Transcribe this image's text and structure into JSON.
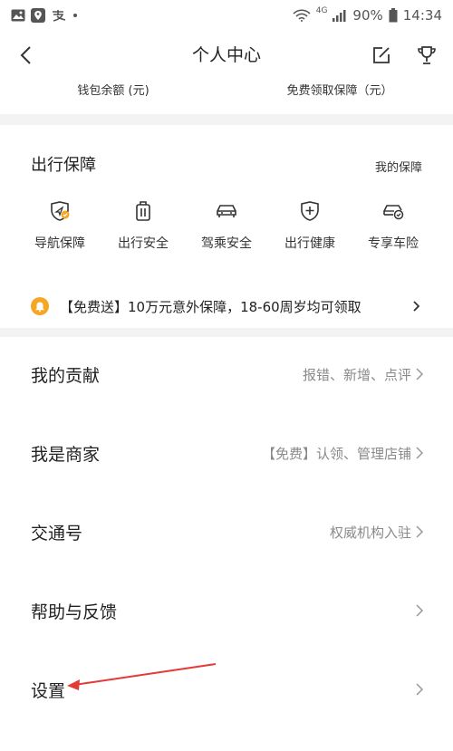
{
  "status_bar": {
    "battery_percent": "90%",
    "time": "14:34",
    "network": "4G",
    "icons": [
      "image-icon",
      "location-icon",
      "alipay-icon",
      "dot-icon",
      "wifi-icon",
      "signal-icon",
      "battery-icon"
    ]
  },
  "nav": {
    "title": "个人中心",
    "icons": [
      "back-arrow-icon",
      "edit-icon",
      "trophy-icon"
    ]
  },
  "wallet": {
    "balance_label": "钱包余额 (元)",
    "free_protect_label": "免费领取保障（元）"
  },
  "protect": {
    "title": "出行保障",
    "link": "我的保障",
    "items": [
      {
        "label": "导航保障",
        "icon": "navigation-shield-icon"
      },
      {
        "label": "出行安全",
        "icon": "luggage-icon"
      },
      {
        "label": "驾乘安全",
        "icon": "car-icon"
      },
      {
        "label": "出行健康",
        "icon": "health-shield-icon"
      },
      {
        "label": "专享车险",
        "icon": "car-insurance-icon"
      }
    ],
    "promo": {
      "text": "【免费送】10万元意外保障，18-60周岁均可领取",
      "icon": "bell-icon"
    }
  },
  "menu": [
    {
      "title": "我的贡献",
      "sub": "报错、新增、点评"
    },
    {
      "title": "我是商家",
      "sub": "【免费】认领、管理店铺"
    },
    {
      "title": "交通号",
      "sub": "权威机构入驻"
    },
    {
      "title": "帮助与反馈",
      "sub": ""
    },
    {
      "title": "设置",
      "sub": ""
    }
  ],
  "colors": {
    "accent_orange": "#f5a623",
    "annotation_red": "#e53935",
    "icon_gray": "#333333",
    "sub_text": "#8a8a8a",
    "divider": "#f3f3f3"
  }
}
